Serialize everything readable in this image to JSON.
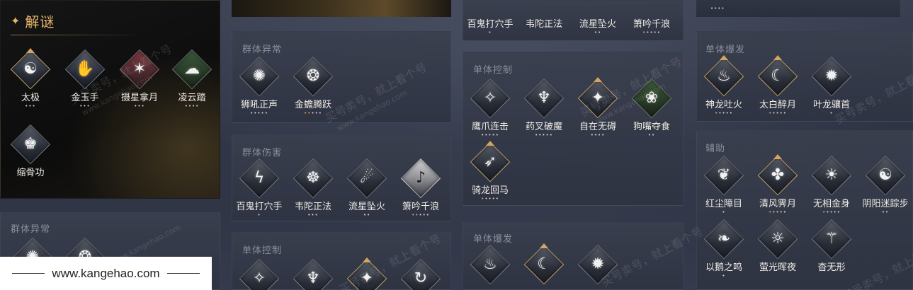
{
  "puzzle": {
    "title": "解谜",
    "skills": [
      {
        "name": "太极",
        "dots": "•••",
        "gold_dots": ""
      },
      {
        "name": "金玉手",
        "dots": "•••",
        "gold_dots": ""
      },
      {
        "name": "摄星拿月",
        "dots": "•••",
        "gold_dots": ""
      },
      {
        "name": "凌云踏",
        "dots": "••••",
        "gold_dots": ""
      },
      {
        "name": "缩骨功",
        "dots": "",
        "gold_dots": ""
      }
    ]
  },
  "col0": {
    "group_abnormal": "群体异常"
  },
  "col1": {
    "group_abnormal": {
      "title": "群体异常",
      "skills": [
        {
          "name": "狮吼正声",
          "dots": "•••••",
          "gold_dots": ""
        },
        {
          "name": "金蟾腾跃",
          "dots": "•••",
          "gold_dots": "••"
        }
      ]
    },
    "group_damage": {
      "title": "群体伤害",
      "skills": [
        {
          "name": "百鬼打穴手",
          "dots": "•",
          "gold_dots": ""
        },
        {
          "name": "韦陀正法",
          "dots": "•••",
          "gold_dots": ""
        },
        {
          "name": "流星坠火",
          "dots": "••",
          "gold_dots": ""
        },
        {
          "name": "箫吟千浪",
          "dots": "•••",
          "gold_dots": "••"
        }
      ]
    },
    "single_control": "单体控制"
  },
  "col2": {
    "top_skills": [
      {
        "name": "百鬼打穴手",
        "dots": "•",
        "gold_dots": ""
      },
      {
        "name": "韦陀正法",
        "dots": "",
        "gold_dots": ""
      },
      {
        "name": "流星坠火",
        "dots": "••",
        "gold_dots": ""
      },
      {
        "name": "箫吟千浪",
        "dots": "••••",
        "gold_dots": "•"
      }
    ],
    "single_control": {
      "title": "单体控制",
      "skills": [
        {
          "name": "鹰爪连击",
          "dots": "•••••",
          "gold_dots": ""
        },
        {
          "name": "药叉破魔",
          "dots": "•••••",
          "gold_dots": ""
        },
        {
          "name": "自在无碍",
          "dots": "••••",
          "gold_dots": ""
        },
        {
          "name": "狗嘴夺食",
          "dots": "••",
          "gold_dots": ""
        },
        {
          "name": "骑龙回马",
          "dots": "••••",
          "gold_dots": "•"
        }
      ]
    },
    "single_burst": "单体爆发"
  },
  "col3": {
    "top_dots": "••••",
    "single_burst": {
      "title": "单体爆发",
      "skills": [
        {
          "name": "神龙吐火",
          "dots": "••••",
          "gold_dots": "•"
        },
        {
          "name": "太白醉月",
          "dots": "••••",
          "gold_dots": "•"
        },
        {
          "name": "叶龙骧首",
          "dots": "•",
          "gold_dots": ""
        }
      ]
    },
    "support": {
      "title": "辅助",
      "skills": [
        {
          "name": "红尘障目",
          "dots": "•",
          "gold_dots": ""
        },
        {
          "name": "清风霁月",
          "dots": "••••",
          "gold_dots": "•"
        },
        {
          "name": "无相金身",
          "dots": "••••",
          "gold_dots": "•"
        },
        {
          "name": "阴阳迷踪步",
          "dots": "••",
          "gold_dots": ""
        },
        {
          "name": "以鹅之鸣",
          "dots": "•",
          "gold_dots": ""
        },
        {
          "name": "萤光晖夜",
          "dots": "",
          "gold_dots": ""
        },
        {
          "name": "杳无形",
          "dots": "",
          "gold_dots": ""
        }
      ]
    }
  },
  "watermark": {
    "text1": "买号卖号，就上看个号",
    "text2": "www.kangehao.com",
    "text3": "看个号"
  },
  "footer": {
    "url": "www.kangehao.com"
  },
  "colors": {
    "accent_gold": "#e6b46a",
    "panel": "#3a3f4e",
    "text": "#f0ede6"
  }
}
